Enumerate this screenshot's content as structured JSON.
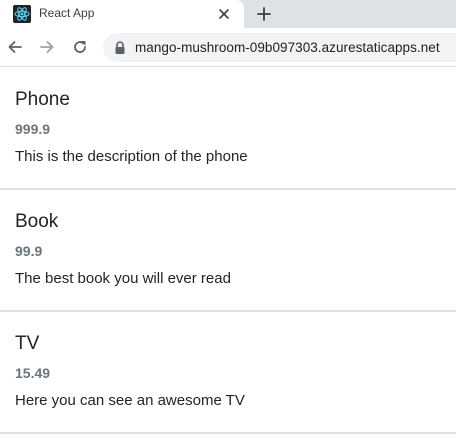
{
  "browser": {
    "tab": {
      "title": "React App",
      "favicon": "react-logo-icon"
    },
    "new_tab_label": "+",
    "url": "mango-mushroom-09b097303.azurestaticapps.net",
    "icons": {
      "back": "arrow-left-icon",
      "forward": "arrow-right-icon",
      "reload": "reload-icon",
      "lock": "lock-icon",
      "close": "close-icon"
    }
  },
  "products": [
    {
      "name": "Phone",
      "price": "999.9",
      "description": "This is the description of the phone"
    },
    {
      "name": "Book",
      "price": "99.9",
      "description": "The best book you will ever read"
    },
    {
      "name": "TV",
      "price": "15.49",
      "description": "Here you can see an awesome TV"
    }
  ],
  "colors": {
    "price": "#6c757d",
    "text": "#212529",
    "divider": "#dee2e6",
    "react_blue": "#61dafb"
  }
}
